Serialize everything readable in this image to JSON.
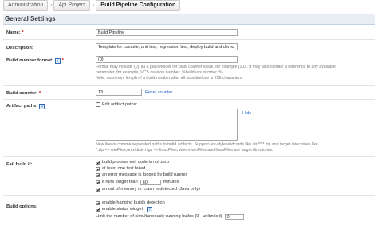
{
  "breadcrumb": [
    "Administration",
    "Api Project",
    "Build Pipeline Configuration"
  ],
  "section": {
    "title": "General Settings"
  },
  "name": {
    "label": "Name:",
    "value": "Build Pipeline"
  },
  "description": {
    "label": "Description:",
    "value": "Template for compile, unit test, regression test, deploy build and demo"
  },
  "build_number_format": {
    "label": "Build number format:",
    "value": "{0}",
    "note_lines": [
      "Format may include '{0}' as a placeholder for build counter value, for example {1.0}. It may also contain a reference to any available",
      "parameter, for example, VCS revision number: %build.vcs.number.*%.",
      "Note: maximum length of a build number after all substitutions is 256 characters."
    ]
  },
  "build_counter": {
    "label": "Build counter:",
    "value": "13",
    "reset_label": "Reset counter"
  },
  "artifact_paths": {
    "label": "Artifact paths:",
    "edit_label": "Edit artifact paths:",
    "hide_label": "Hide",
    "value": "",
    "note_lines": [
      "New line or comma separated paths to build artifacts. Support ant-style wildcards like dir/**/*.zip and target directories like",
      "*.zip => winFiles,unix/distro.tgz => linuxFiles, where winFiles and linuxFiles are target directories."
    ]
  },
  "fail_build": {
    "label": "Fail build if:",
    "options": [
      {
        "label": "build process exit code is not zero",
        "checked": true
      },
      {
        "label": "at least one test failed",
        "checked": true
      },
      {
        "label": "an error message is logged by build runner",
        "checked": true
      },
      {
        "label": "it runs longer than",
        "checked": true,
        "value": "60",
        "suffix": "minutes"
      },
      {
        "label": "an out of memory or crash is detected (Java only)",
        "checked": true
      }
    ]
  },
  "build_options": {
    "label": "Build options:",
    "options": [
      {
        "label": "enable hanging builds detection",
        "checked": true
      },
      {
        "label": "enable status widget",
        "checked": true
      }
    ],
    "limit_label": "Limit the number of simultaneously running builds (0 - unlimited)",
    "limit_value": "0"
  }
}
